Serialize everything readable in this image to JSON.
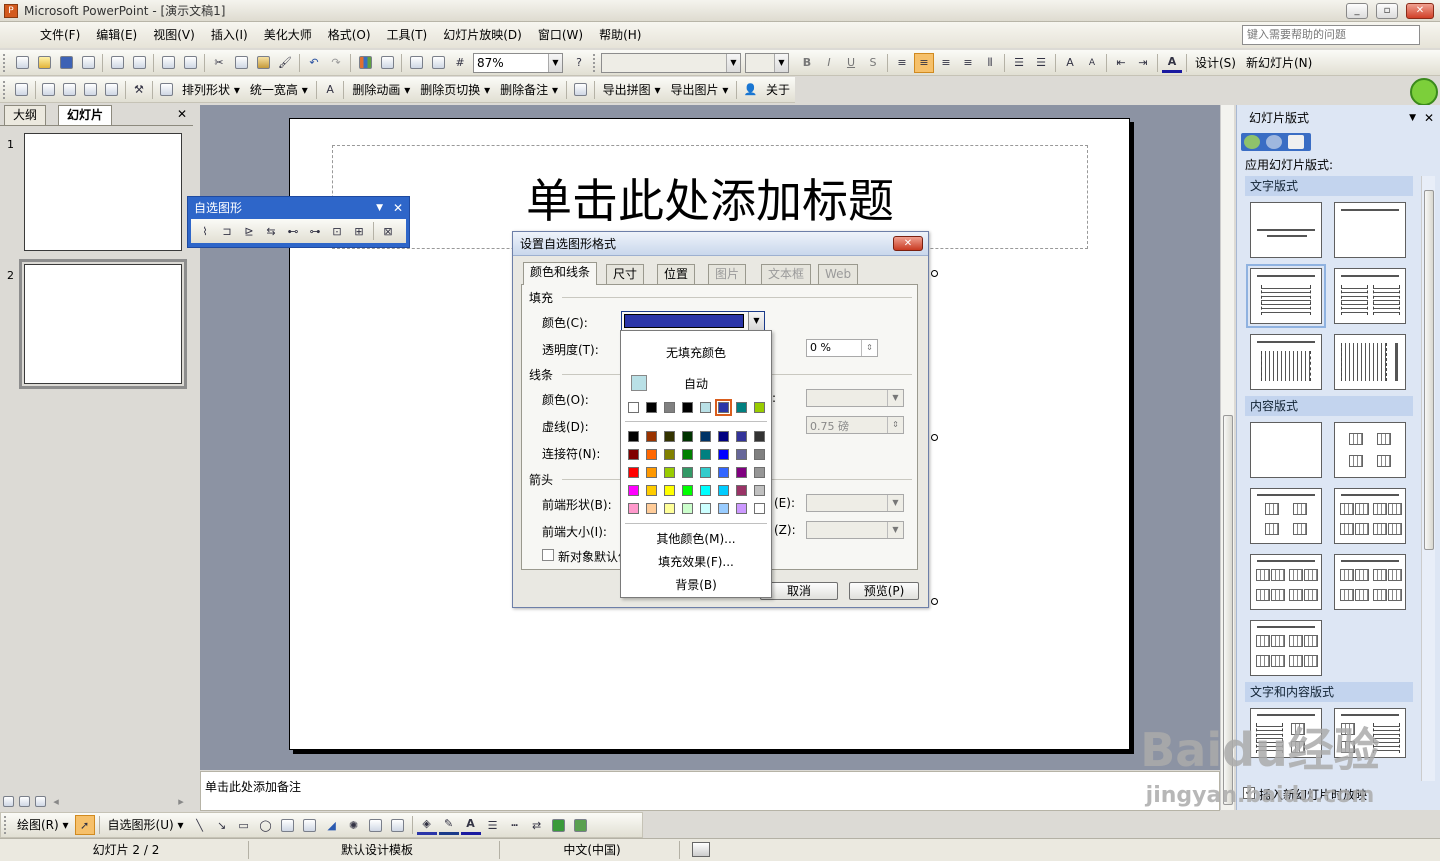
{
  "window": {
    "title": "Microsoft PowerPoint - [演示文稿1]",
    "app_icon": "P",
    "controls": {
      "minimize": "_",
      "restore": "▫",
      "close": "✕"
    }
  },
  "menu": {
    "items": [
      "文件(F)",
      "编辑(E)",
      "视图(V)",
      "插入(I)",
      "美化大师",
      "格式(O)",
      "工具(T)",
      "幻灯片放映(D)",
      "窗口(W)",
      "帮助(H)"
    ],
    "help_placeholder": "键入需要帮助的问题"
  },
  "toolbar1": {
    "zoom": "87%",
    "bold": "B",
    "italic": "I",
    "underline": "U",
    "shadow": "S",
    "design_label": "设计(S)",
    "new_slide_label": "新幻灯片(N)"
  },
  "toolbar2": {
    "arrange": "排列形状",
    "unify": "统一宽高",
    "delete_anim": "删除动画",
    "delete_trans": "删除页切换",
    "delete_notes": "删除备注",
    "export_puzzle": "导出拼图",
    "export_image": "导出图片",
    "about": "关于"
  },
  "left_pane": {
    "tabs": [
      "大纲",
      "幻灯片"
    ],
    "close": "✕",
    "slides": [
      "1",
      "2"
    ]
  },
  "slide": {
    "title_placeholder": "单击此处添加标题"
  },
  "autoshape_toolbar": {
    "title": "自选图形",
    "close": "✕",
    "tools": [
      "⌇",
      "⊐",
      "⊵",
      "⇆",
      "⊷",
      "⊶",
      "⊡",
      "⊞",
      "⊠"
    ]
  },
  "dialog": {
    "title": "设置自选图形格式",
    "close": "✕",
    "tabs": [
      "颜色和线条",
      "尺寸",
      "位置",
      "图片",
      "文本框",
      "Web"
    ],
    "fill_group": "填充",
    "fill_color_label": "颜色(C):",
    "fill_color_hex": "#2a35a8",
    "transparency_label": "透明度(T):",
    "transparency_value": "0 %",
    "line_group": "线条",
    "line_color_label": "颜色(O):",
    "dash_label": "虚线(D):",
    "weight_value": "0.75 磅",
    "connector_label": "连接符(N):",
    "arrow_group": "箭头",
    "begin_style_label": "前端形状(B):",
    "begin_size_label": "前端大小(I):",
    "end_style_suffix": "(E):",
    "end_size_suffix": "(Z):",
    "style_colon": ":",
    "default_checkbox": "新对象默认值",
    "cancel": "取消",
    "preview": "预览(P)"
  },
  "color_dropdown": {
    "no_fill": "无填充颜色",
    "auto": "自动",
    "auto_color": "#b9e0e6",
    "recent": [
      "#ffffff",
      "#000000",
      "#808080",
      "#000000",
      "#b9e0e6",
      "#2a35a8",
      "#008080",
      "#99cc00"
    ],
    "palette": [
      [
        "#000000",
        "#993300",
        "#333300",
        "#003300",
        "#003366",
        "#000080",
        "#333399",
        "#333333"
      ],
      [
        "#800000",
        "#ff6600",
        "#808000",
        "#008000",
        "#008080",
        "#0000ff",
        "#666699",
        "#808080"
      ],
      [
        "#ff0000",
        "#ff9900",
        "#99cc00",
        "#339966",
        "#33cccc",
        "#3366ff",
        "#800080",
        "#969696"
      ],
      [
        "#ff00ff",
        "#ffcc00",
        "#ffff00",
        "#00ff00",
        "#00ffff",
        "#00ccff",
        "#993366",
        "#c0c0c0"
      ],
      [
        "#ff99cc",
        "#ffcc99",
        "#ffff99",
        "#ccffcc",
        "#ccffff",
        "#99ccff",
        "#cc99ff",
        "#ffffff"
      ]
    ],
    "more_colors": "其他颜色(M)...",
    "fill_effects": "填充效果(F)...",
    "background": "背景(B)"
  },
  "task_pane": {
    "title": "幻灯片版式",
    "close": "✕",
    "apply_label": "应用幻灯片版式:",
    "sections": [
      "文字版式",
      "内容版式",
      "文字和内容版式"
    ],
    "insert_checkbox": "插入新幻灯片时放映"
  },
  "notes": {
    "placeholder": "单击此处添加备注"
  },
  "drawbar": {
    "draw": "绘图(R)",
    "autoshapes": "自选图形(U)"
  },
  "status": {
    "slide_pos": "幻灯片 2 / 2",
    "template": "默认设计模板",
    "language": "中文(中国)"
  },
  "watermark": {
    "line1": "Baidu经验",
    "line2": "jingyan.baidu.com"
  }
}
